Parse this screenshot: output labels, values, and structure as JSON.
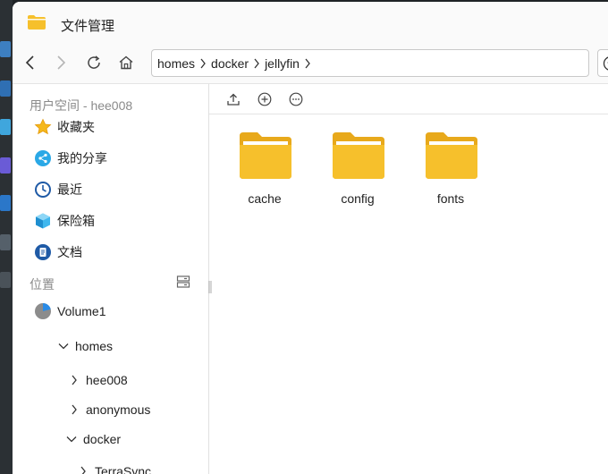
{
  "window": {
    "title": "文件管理"
  },
  "nav": {
    "breadcrumb": [
      "homes",
      "docker",
      "jellyfin"
    ]
  },
  "sidebar": {
    "user_space_label": "用户空间 - hee008",
    "items": [
      {
        "label": "收藏夹",
        "icon": "star-icon"
      },
      {
        "label": "我的分享",
        "icon": "share-icon"
      },
      {
        "label": "最近",
        "icon": "clock-icon"
      },
      {
        "label": "保险箱",
        "icon": "safe-box-icon"
      },
      {
        "label": "文档",
        "icon": "document-icon"
      }
    ],
    "location_label": "位置",
    "volume": "Volume1",
    "tree": [
      {
        "label": "homes",
        "expanded": true
      },
      {
        "label": "hee008",
        "expanded": false
      },
      {
        "label": "anonymous",
        "expanded": false
      },
      {
        "label": "docker",
        "expanded": true
      },
      {
        "label": "TerraSync",
        "expanded": false
      }
    ]
  },
  "files": [
    {
      "name": "cache",
      "type": "folder"
    },
    {
      "name": "config",
      "type": "folder"
    },
    {
      "name": "fonts",
      "type": "folder"
    }
  ],
  "colors": {
    "folder": "#f6c02c",
    "folder_dark": "#e8a91b",
    "accent_blue": "#2a8be6"
  }
}
